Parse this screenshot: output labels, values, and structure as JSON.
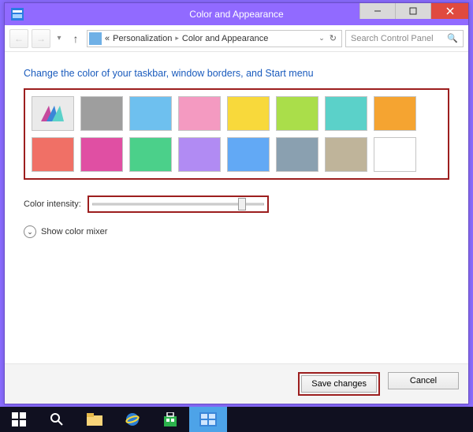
{
  "window": {
    "title": "Color and Appearance",
    "controls": {
      "minimize": "─",
      "maximize": "☐",
      "close": "✕"
    }
  },
  "nav": {
    "back": "←",
    "forward": "→",
    "up": "↑",
    "breadcrumb": {
      "pre": "«",
      "parent": "Personalization",
      "current": "Color and Appearance"
    },
    "refresh": "↻",
    "search_placeholder": "Search Control Panel"
  },
  "content": {
    "heading": "Change the color of your taskbar, window borders, and Start menu",
    "swatches": [
      {
        "auto": true
      },
      {
        "color": "#9e9e9e"
      },
      {
        "color": "#6ec0ef"
      },
      {
        "color": "#f49ac1"
      },
      {
        "color": "#f8d93b"
      },
      {
        "color": "#aade4a"
      },
      {
        "color": "#5bd1c9"
      },
      {
        "color": "#f5a431"
      },
      {
        "color": "#f07066"
      },
      {
        "color": "#e04fa3"
      },
      {
        "color": "#4bd08a"
      },
      {
        "color": "#b18bf3"
      },
      {
        "color": "#62a9f5"
      },
      {
        "color": "#8aa0b0"
      },
      {
        "color": "#bfb49a"
      },
      {
        "color": "#ffffff"
      }
    ],
    "intensity_label": "Color intensity:",
    "intensity_value": 85,
    "mixer_label": "Show color mixer"
  },
  "footer": {
    "save": "Save changes",
    "cancel": "Cancel"
  },
  "taskbar": {
    "items": [
      "start",
      "search",
      "explorer",
      "ie",
      "store",
      "control-panel"
    ]
  }
}
